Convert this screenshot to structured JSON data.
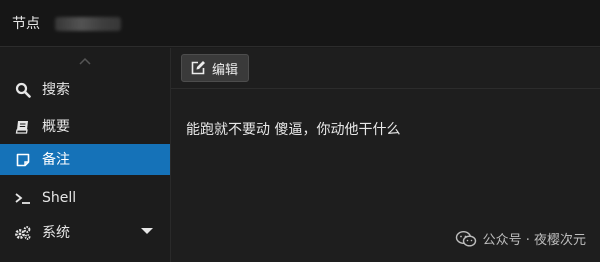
{
  "titlebar": {
    "title": "节点"
  },
  "sidebar": {
    "items": [
      {
        "label": "搜索",
        "icon": "search-icon"
      },
      {
        "label": "概要",
        "icon": "book-icon"
      },
      {
        "label": "备注",
        "icon": "note-icon",
        "active": true
      },
      {
        "label": "Shell",
        "icon": "terminal-icon"
      },
      {
        "label": "系统",
        "icon": "gears-icon"
      }
    ]
  },
  "toolbar": {
    "edit_label": "编辑"
  },
  "note": {
    "content": "能跑就不要动 傻逼，你动他干什么"
  },
  "watermark": {
    "text": "公众号 · 夜樱次元"
  },
  "colors": {
    "accent": "#1572b8",
    "background": "#1b1b1b",
    "text": "#e6e6e6"
  }
}
